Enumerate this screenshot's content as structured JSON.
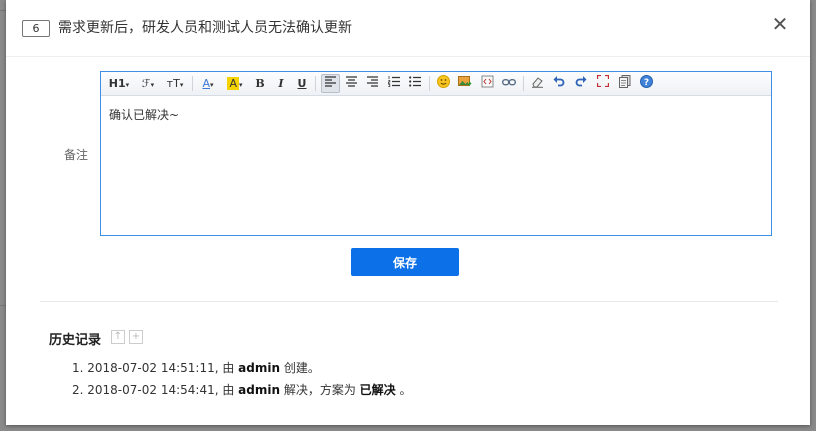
{
  "dialog": {
    "id": "6",
    "title": "需求更新后，研发人员和测试人员无法确认更新",
    "close_symbol": "✕"
  },
  "form": {
    "remark_label": "备注",
    "editor_content": "确认已解决~",
    "save_label": "保存"
  },
  "toolbar": {
    "heading": "H1",
    "font_family": "ℱ",
    "font_size": "ᴛT",
    "font_color": "A",
    "bg_color": "A",
    "bold": "B",
    "italic": "I",
    "underline": "U",
    "emoticon": "☺",
    "help": "?"
  },
  "history": {
    "title": "历史记录",
    "entries": [
      {
        "prefix": "1. 2018-07-02 14:51:11, 由 ",
        "user": "admin",
        "action": " 创建。",
        "extra": "",
        "tail": ""
      },
      {
        "prefix": "2. 2018-07-02 14:54:41, 由 ",
        "user": "admin",
        "action": " 解决，方案为 ",
        "extra": "已解决",
        "tail": " 。"
      }
    ]
  },
  "colors": {
    "primary": "#0c70e8",
    "editor_border": "#3f8ee6",
    "font_color_icon": "#3c78d8",
    "bg_color_icon": "#f5d300"
  }
}
